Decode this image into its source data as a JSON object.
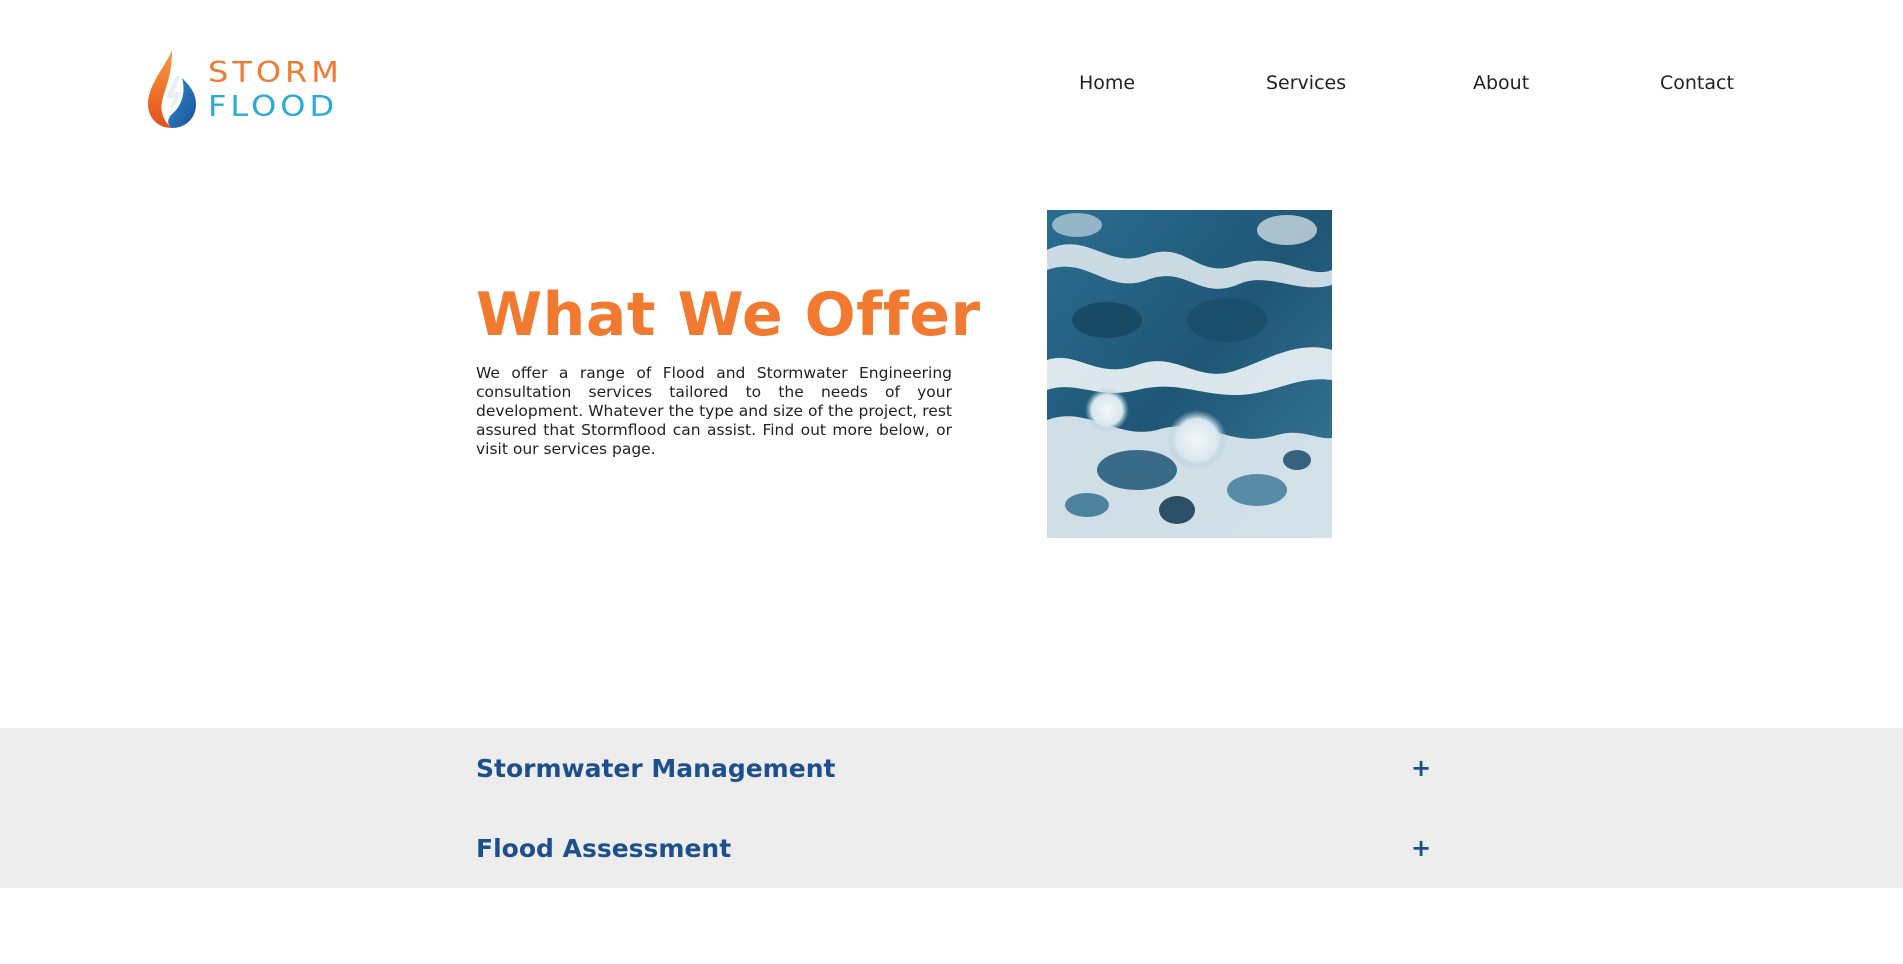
{
  "brand": {
    "logo_word_1": "STORM",
    "logo_word_2": "FLOOD",
    "colors": {
      "orange": "#f27a30",
      "cyan": "#2aaad9",
      "navy": "#1d4f8a"
    }
  },
  "nav": {
    "items": [
      {
        "label": "Home"
      },
      {
        "label": "Services"
      },
      {
        "label": "About"
      },
      {
        "label": "Contact"
      }
    ]
  },
  "offer": {
    "title": "What We Offer",
    "body": "We offer a range of Flood and Stormwater Engineering consultation services tailored to the needs of your development. Whatever the type and size of the project, rest assured that Stormflood can assist. Find out more below, or visit our services page."
  },
  "image": {
    "subject": "ocean-foam-photo"
  },
  "accordion": {
    "items": [
      {
        "title": "Stormwater Management",
        "toggle": "+"
      },
      {
        "title": "Flood Assessment",
        "toggle": "+"
      }
    ]
  }
}
